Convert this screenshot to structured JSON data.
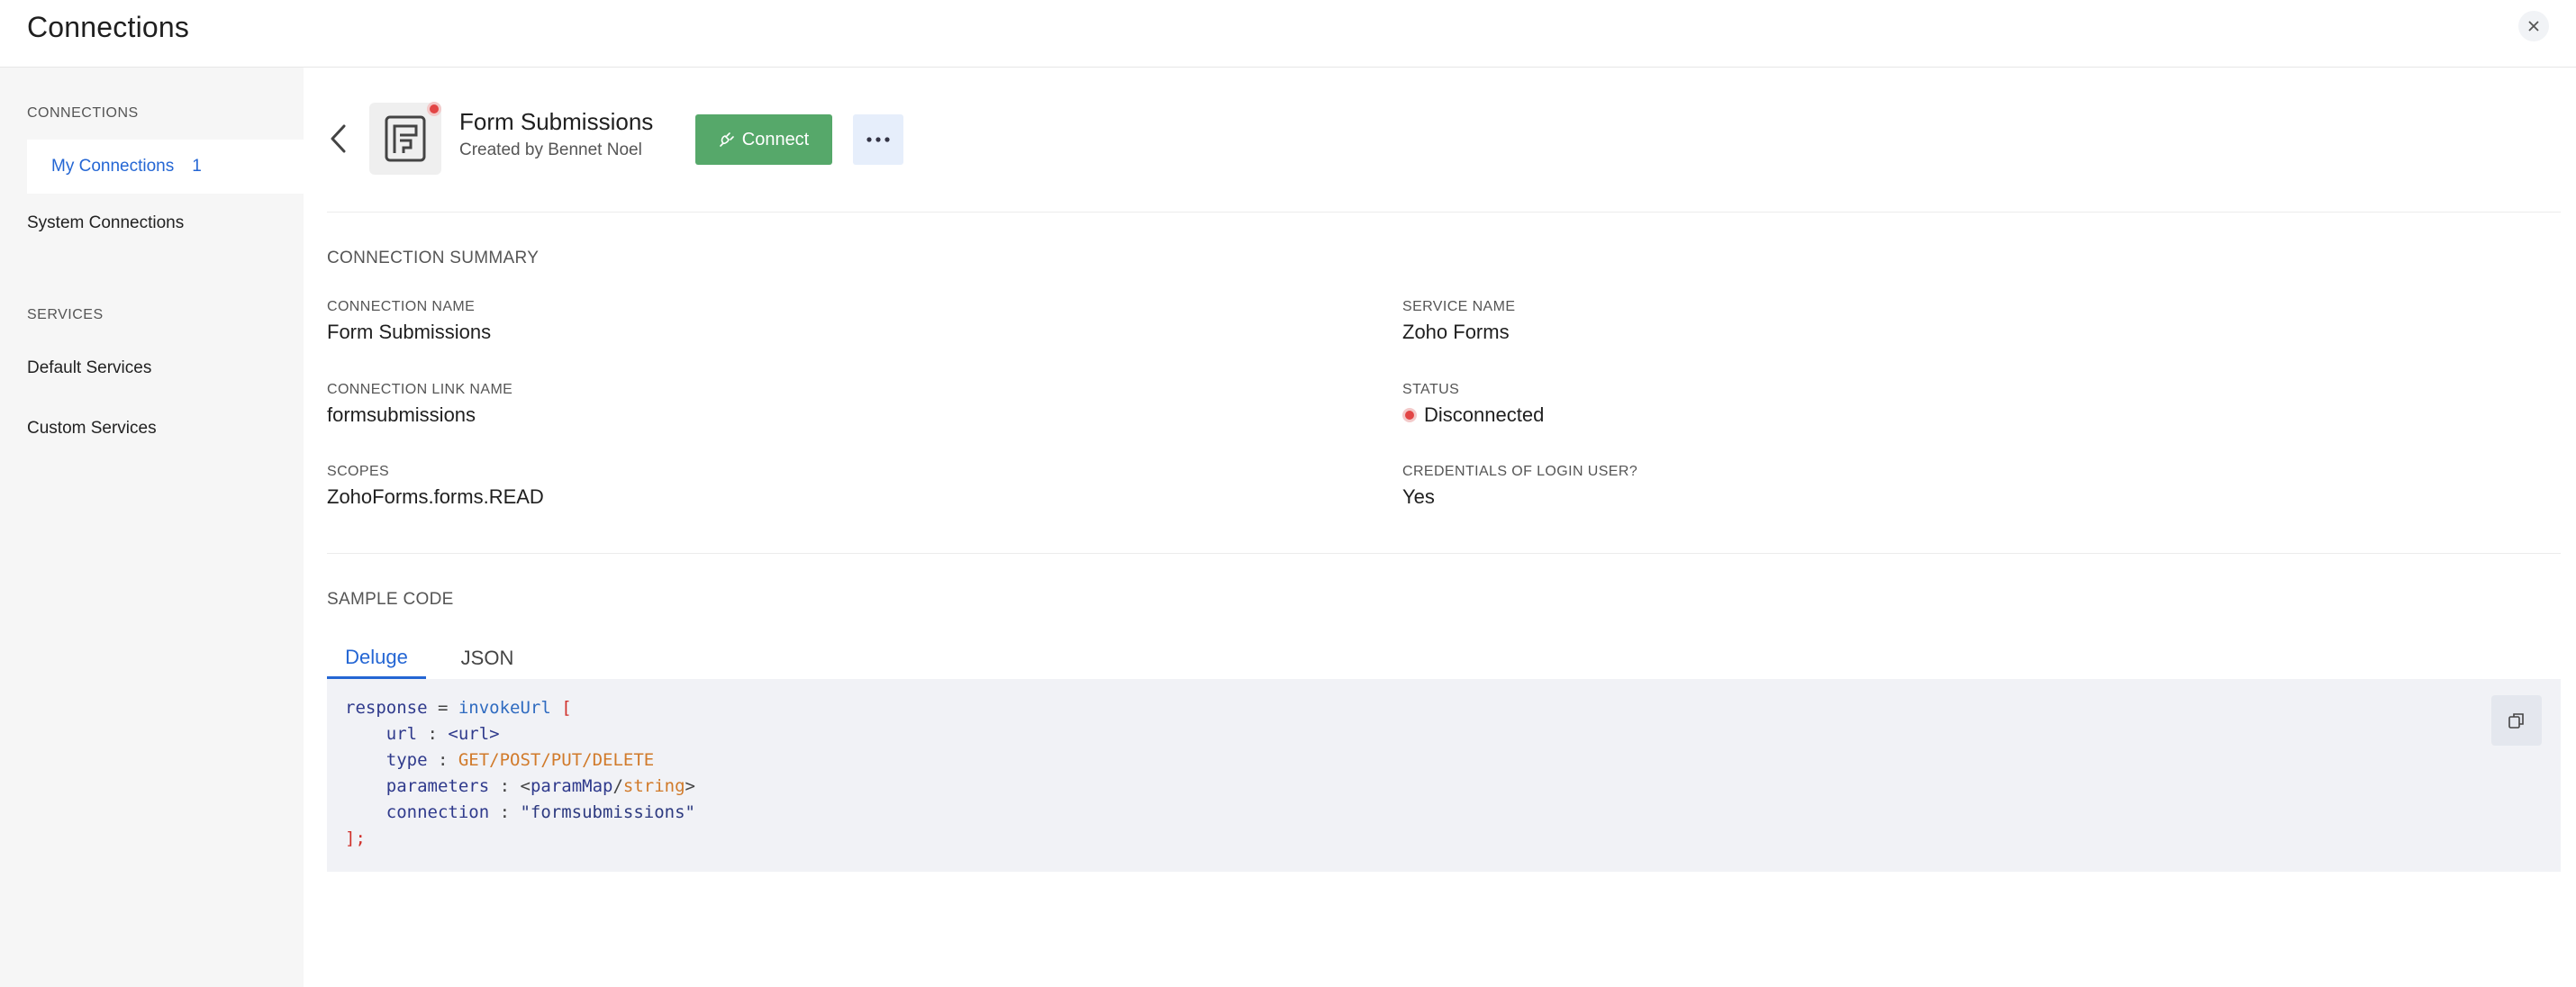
{
  "header": {
    "title": "Connections"
  },
  "sidebar": {
    "connections_heading": "CONNECTIONS",
    "items": [
      {
        "label": "My Connections",
        "count": "1"
      },
      {
        "label": "System Connections"
      }
    ],
    "services_heading": "SERVICES",
    "service_items": [
      {
        "label": "Default Services"
      },
      {
        "label": "Custom Services"
      }
    ]
  },
  "connection": {
    "name": "Form Submissions",
    "creator": "Created by Bennet Noel",
    "connect_label": "Connect",
    "status_color": "#e24545"
  },
  "summary": {
    "title": "CONNECTION SUMMARY",
    "fields": [
      {
        "label": "CONNECTION NAME",
        "value": "Form Submissions"
      },
      {
        "label": "SERVICE NAME",
        "value": "Zoho Forms"
      },
      {
        "label": "CONNECTION LINK NAME",
        "value": "formsubmissions"
      },
      {
        "label": "STATUS",
        "value": "Disconnected"
      },
      {
        "label": "SCOPES",
        "value": "ZohoForms.forms.READ"
      },
      {
        "label": "CREDENTIALS OF LOGIN USER?",
        "value": "Yes"
      }
    ]
  },
  "sample_code": {
    "title": "SAMPLE CODE",
    "tabs": [
      {
        "label": "Deluge"
      },
      {
        "label": "JSON"
      }
    ],
    "code": {
      "l1_var": "response",
      "l1_eq": " = ",
      "l1_fn": "invokeUrl",
      "l1_br": " [",
      "l2_key": "url",
      "l2_sep": " : ",
      "l2_val": "<url>",
      "l3_key": "type",
      "l3_sep": " : ",
      "l3_val": "GET/POST/PUT/DELETE",
      "l4_key": "parameters",
      "l4_sep": " : ",
      "l4_open": "<",
      "l4_v1": "paramMap",
      "l4_slash": "/",
      "l4_v2": "string",
      "l4_close": ">",
      "l5_key": "connection",
      "l5_sep": " : ",
      "l5_val": "\"formsubmissions\"",
      "l6_close": "];"
    }
  },
  "colors": {
    "accent": "#2466d4",
    "connect_button": "#56a86a",
    "status_disconnected": "#e24545"
  }
}
